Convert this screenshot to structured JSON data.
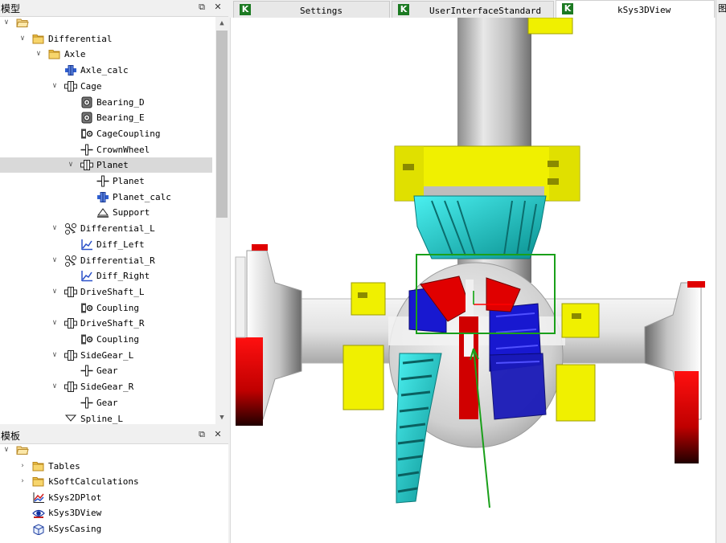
{
  "model_panel": {
    "title": "模型",
    "float_icon": "float-icon",
    "close_icon": "close-icon",
    "tree": [
      {
        "label": "",
        "icon": "folder-open-icon"
      },
      {
        "label": "Differential",
        "icon": "folder-icon"
      },
      {
        "label": "Axle",
        "icon": "folder-icon"
      },
      {
        "label": "Axle_calc",
        "icon": "calc-icon"
      },
      {
        "label": "Cage",
        "icon": "assembly-icon"
      },
      {
        "label": "Bearing_D",
        "icon": "bearing-icon"
      },
      {
        "label": "Bearing_E",
        "icon": "bearing-icon"
      },
      {
        "label": "CageCoupling",
        "icon": "coupling-icon"
      },
      {
        "label": "CrownWheel",
        "icon": "gear-icon"
      },
      {
        "label": "Planet",
        "icon": "assembly-icon"
      },
      {
        "label": "Planet",
        "icon": "gear-icon"
      },
      {
        "label": "Planet_calc",
        "icon": "calc-icon"
      },
      {
        "label": "Support",
        "icon": "support-icon"
      },
      {
        "label": "Differential_L",
        "icon": "link-icon"
      },
      {
        "label": "Diff_Left",
        "icon": "plot-icon"
      },
      {
        "label": "Differential_R",
        "icon": "link-icon"
      },
      {
        "label": "Diff_Right",
        "icon": "plot-icon"
      },
      {
        "label": "DriveShaft_L",
        "icon": "assembly-icon"
      },
      {
        "label": "Coupling",
        "icon": "coupling-icon"
      },
      {
        "label": "DriveShaft_R",
        "icon": "assembly-icon"
      },
      {
        "label": "Coupling",
        "icon": "coupling-icon"
      },
      {
        "label": "SideGear_L",
        "icon": "assembly-icon"
      },
      {
        "label": "Gear",
        "icon": "gear-icon"
      },
      {
        "label": "SideGear_R",
        "icon": "assembly-icon"
      },
      {
        "label": "Gear",
        "icon": "gear-icon"
      },
      {
        "label": "Spline_L",
        "icon": "spline-icon"
      }
    ]
  },
  "template_panel": {
    "title": "模板",
    "tree": [
      {
        "label": "",
        "icon": "folder-open-icon"
      },
      {
        "label": "Tables",
        "icon": "folder-icon"
      },
      {
        "label": "kSoftCalculations",
        "icon": "folder-icon"
      },
      {
        "label": "kSys2DPlot",
        "icon": "plot2d-icon"
      },
      {
        "label": "kSys3DView",
        "icon": "eye-icon"
      },
      {
        "label": "kSysCasing",
        "icon": "casing-icon"
      }
    ]
  },
  "tabs": [
    {
      "label": "Settings",
      "icon": "k-icon",
      "active": false
    },
    {
      "label": "UserInterfaceStandard",
      "icon": "k-icon",
      "active": false
    },
    {
      "label": "kSys3DView",
      "icon": "k-icon",
      "active": true
    }
  ],
  "right_strip_label": "图",
  "colors": {
    "shaft_gray": "#c8c8c8",
    "bearing_yellow": "#f0f000",
    "crown_cyan": "#22d8d8",
    "gear_blue": "#1818d0",
    "flange_red": "#e00000",
    "selection_green": "#1aa01a",
    "tab_k_green": "#1c7a22"
  }
}
